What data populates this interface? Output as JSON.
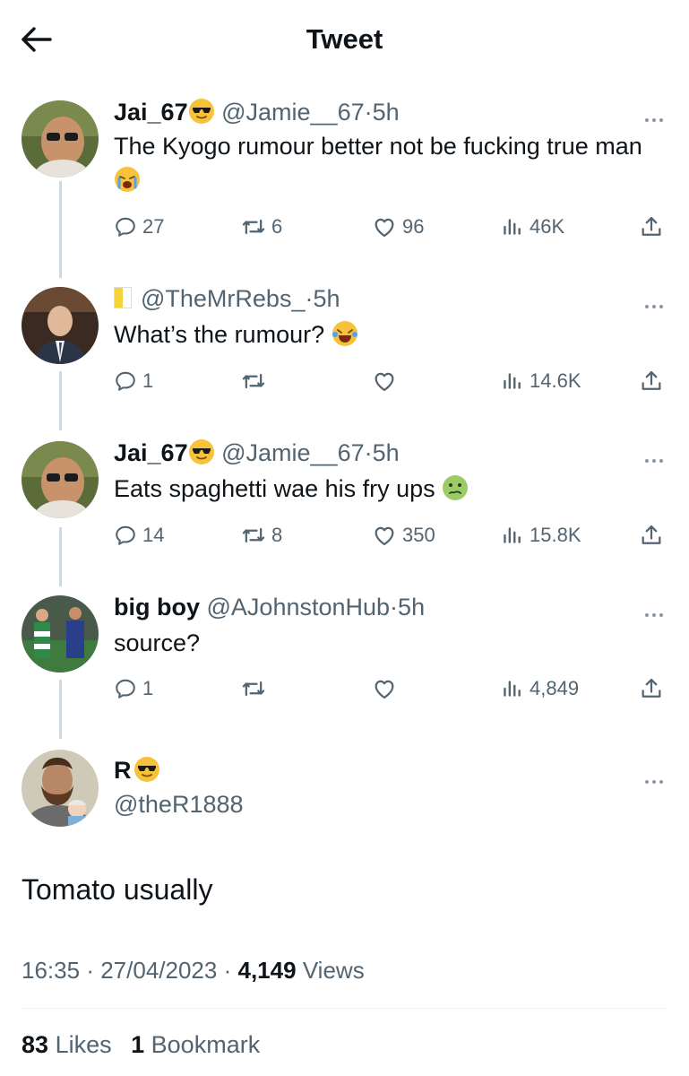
{
  "header": {
    "title": "Tweet"
  },
  "replies": [
    {
      "name": "Jai_67",
      "handle": "@Jamie__67",
      "sep": "·",
      "time": "5h",
      "text": "The Kyogo rumour better not be fucking true man",
      "reply_count": "27",
      "retweet_count": "6",
      "like_count": "96",
      "view_count": "46K"
    },
    {
      "name": "",
      "handle": "@TheMrRebs_",
      "sep": "·",
      "time": "5h",
      "text": "What’s the rumour?",
      "reply_count": "1",
      "retweet_count": "",
      "like_count": "",
      "view_count": "14.6K"
    },
    {
      "name": "Jai_67",
      "handle": "@Jamie__67",
      "sep": "·",
      "time": "5h",
      "text": "Eats spaghetti wae his fry ups",
      "reply_count": "14",
      "retweet_count": "8",
      "like_count": "350",
      "view_count": "15.8K"
    },
    {
      "name": "big boy",
      "handle": "@AJohnstonHub",
      "sep": "·",
      "time": "5h",
      "text": "source?",
      "reply_count": "1",
      "retweet_count": "",
      "like_count": "",
      "view_count": "4,849"
    }
  ],
  "main_tweet": {
    "name": "R",
    "handle": "@theR1888",
    "text": "Tomato usually",
    "time": "16:35",
    "date": "27/04/2023",
    "sep": "·",
    "views_count": "4,149",
    "views_label": "Views",
    "likes_count": "83",
    "likes_label": "Likes",
    "bookmarks_count": "1",
    "bookmarks_label": "Bookmark"
  },
  "icons": {
    "back": "arrow-left-icon",
    "more": "more-icon",
    "reply": "reply-icon",
    "retweet": "retweet-icon",
    "like": "heart-icon",
    "views": "views-icon",
    "share": "share-icon"
  },
  "colors": {
    "text": "#0f1419",
    "secondary": "#536471",
    "line": "#cfd9de",
    "emoji": "#f7c23b"
  }
}
